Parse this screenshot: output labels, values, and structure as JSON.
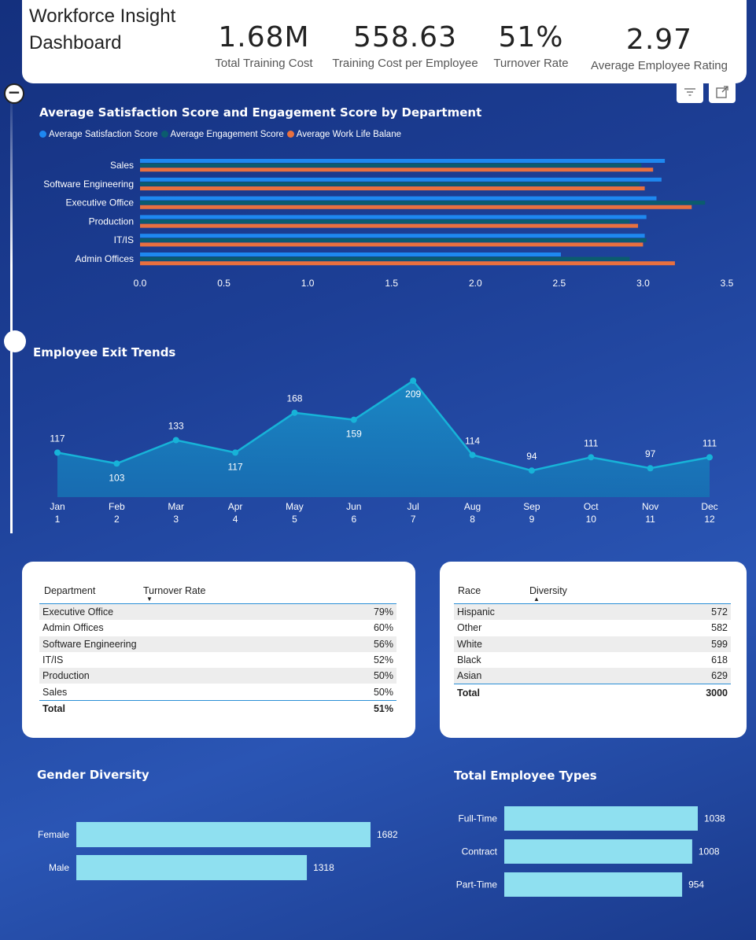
{
  "header": {
    "title": "Workforce Insight Dashboard",
    "kpis": [
      {
        "value": "1.68M",
        "label": "Total Training Cost"
      },
      {
        "value": "558.63",
        "label": "Training Cost per Employee"
      },
      {
        "value": "51%",
        "label": "Turnover Rate"
      },
      {
        "value": "2.97",
        "label": "Average Employee Rating"
      }
    ]
  },
  "icons": {
    "filter": "filter-icon",
    "expand": "focus-mode-icon",
    "collapse": "collapse-icon"
  },
  "satisfaction_chart": {
    "title": "Average Satisfaction Score and Engagement Score by Department",
    "legend": [
      "Average Satisfaction Score",
      "Average Engagement Score",
      "Average Work Life Balane"
    ]
  },
  "exit_chart": {
    "title": "Employee Exit Trends"
  },
  "turnover_table": {
    "headers": [
      "Department",
      "Turnover Rate"
    ],
    "rows": [
      [
        "Executive Office",
        "79%"
      ],
      [
        "Admin Offices",
        "60%"
      ],
      [
        "Software Engineering",
        "56%"
      ],
      [
        "IT/IS",
        "52%"
      ],
      [
        "Production",
        "50%"
      ],
      [
        "Sales",
        "50%"
      ]
    ],
    "total": [
      "Total",
      "51%"
    ]
  },
  "diversity_table": {
    "headers": [
      "Race",
      "Diversity"
    ],
    "rows": [
      [
        "Hispanic",
        "572"
      ],
      [
        "Other",
        "582"
      ],
      [
        "White",
        "599"
      ],
      [
        "Black",
        "618"
      ],
      [
        "Asian",
        "629"
      ]
    ],
    "total": [
      "Total",
      "3000"
    ]
  },
  "gender_chart": {
    "title": "Gender Diversity"
  },
  "types_chart": {
    "title": "Total Employee Types"
  },
  "chart_data": [
    {
      "type": "bar",
      "orientation": "horizontal",
      "title": "Average Satisfaction Score and Engagement Score by Department",
      "categories": [
        "Sales",
        "Software Engineering",
        "Executive Office",
        "Production",
        "IT/IS",
        "Admin Offices"
      ],
      "series": [
        {
          "name": "Average Satisfaction Score",
          "color": "#1e88f0",
          "values": [
            3.13,
            3.11,
            3.08,
            3.02,
            3.01,
            2.51
          ]
        },
        {
          "name": "Average Engagement Score",
          "color": "#0b5c6e",
          "values": [
            2.99,
            2.98,
            3.37,
            2.92,
            3.02,
            2.92
          ]
        },
        {
          "name": "Average Work Life Balane",
          "color": "#e8703f",
          "values": [
            3.06,
            3.01,
            3.29,
            2.97,
            3.0,
            3.19
          ]
        }
      ],
      "xlim": [
        0,
        3.5
      ],
      "xticks": [
        "0.0",
        "0.5",
        "1.0",
        "1.5",
        "2.0",
        "2.5",
        "3.0",
        "3.5"
      ],
      "legend": "top-left"
    },
    {
      "type": "area",
      "title": "Employee Exit Trends",
      "categories": [
        "Jan",
        "Feb",
        "Mar",
        "Apr",
        "May",
        "Jun",
        "Jul",
        "Aug",
        "Sep",
        "Oct",
        "Nov",
        "Dec"
      ],
      "sublabels": [
        "1",
        "2",
        "3",
        "4",
        "5",
        "6",
        "7",
        "8",
        "9",
        "10",
        "11",
        "12"
      ],
      "values": [
        117,
        103,
        133,
        117,
        168,
        159,
        209,
        114,
        94,
        111,
        97,
        111
      ],
      "color": "#17b3d8"
    },
    {
      "type": "bar",
      "orientation": "horizontal",
      "title": "Gender Diversity",
      "categories": [
        "Female",
        "Male"
      ],
      "values": [
        1682,
        1318
      ],
      "color": "#8fe0f0"
    },
    {
      "type": "bar",
      "orientation": "horizontal",
      "title": "Total Employee Types",
      "categories": [
        "Full-Time",
        "Contract",
        "Part-Time"
      ],
      "values": [
        1038,
        1008,
        954
      ],
      "color": "#8fe0f0"
    }
  ]
}
